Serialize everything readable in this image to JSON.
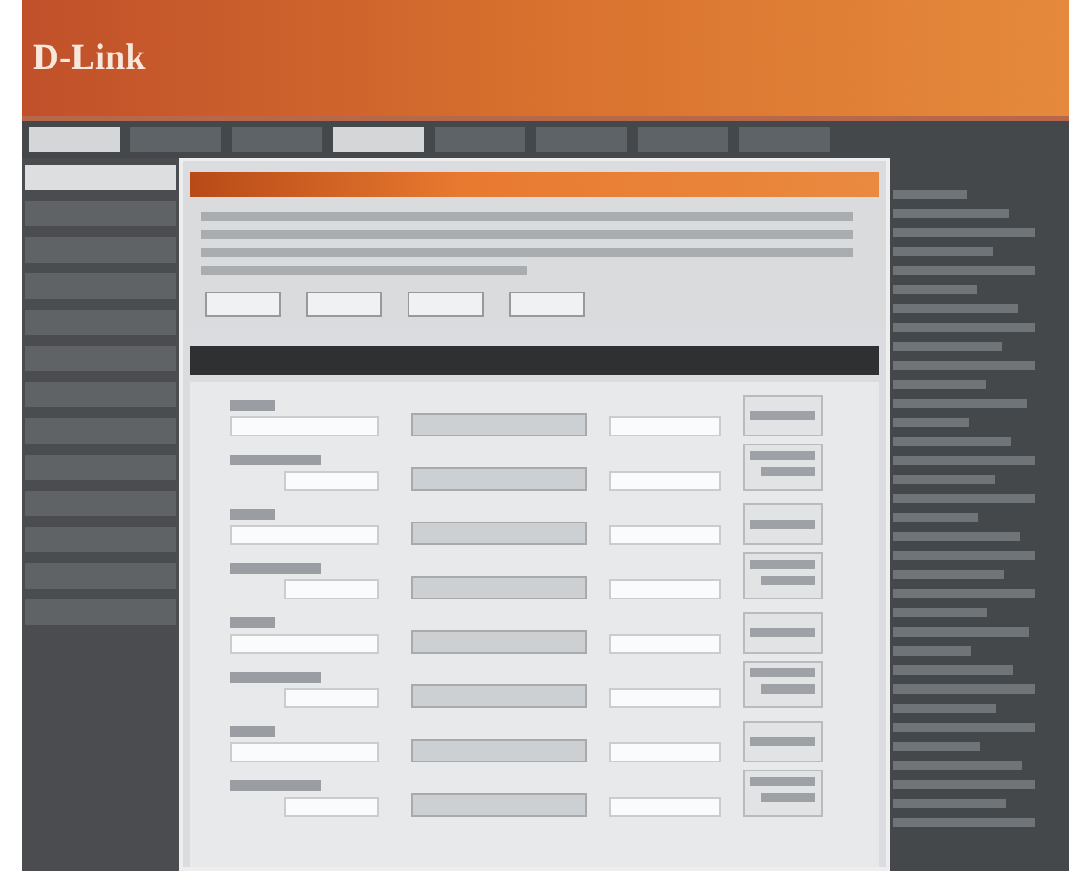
{
  "logo": "D-Link",
  "tabs": [
    {
      "selected": true
    },
    {
      "selected": false
    },
    {
      "selected": false
    },
    {
      "selected": true
    },
    {
      "selected": false
    },
    {
      "selected": false
    },
    {
      "selected": false
    },
    {
      "selected": false
    }
  ],
  "sidebar": {
    "items": [
      {
        "selected": true
      },
      {
        "selected": false
      },
      {
        "selected": false
      },
      {
        "selected": false
      },
      {
        "selected": false
      },
      {
        "selected": false
      },
      {
        "selected": false
      },
      {
        "selected": false
      },
      {
        "selected": false
      },
      {
        "selected": false
      },
      {
        "selected": false
      },
      {
        "selected": false
      },
      {
        "selected": false
      }
    ]
  },
  "rows": [
    {
      "kind": "short"
    },
    {
      "kind": "long"
    },
    {
      "kind": "short"
    },
    {
      "kind": "long"
    },
    {
      "kind": "short"
    },
    {
      "kind": "long"
    },
    {
      "kind": "short"
    },
    {
      "kind": "long"
    }
  ]
}
